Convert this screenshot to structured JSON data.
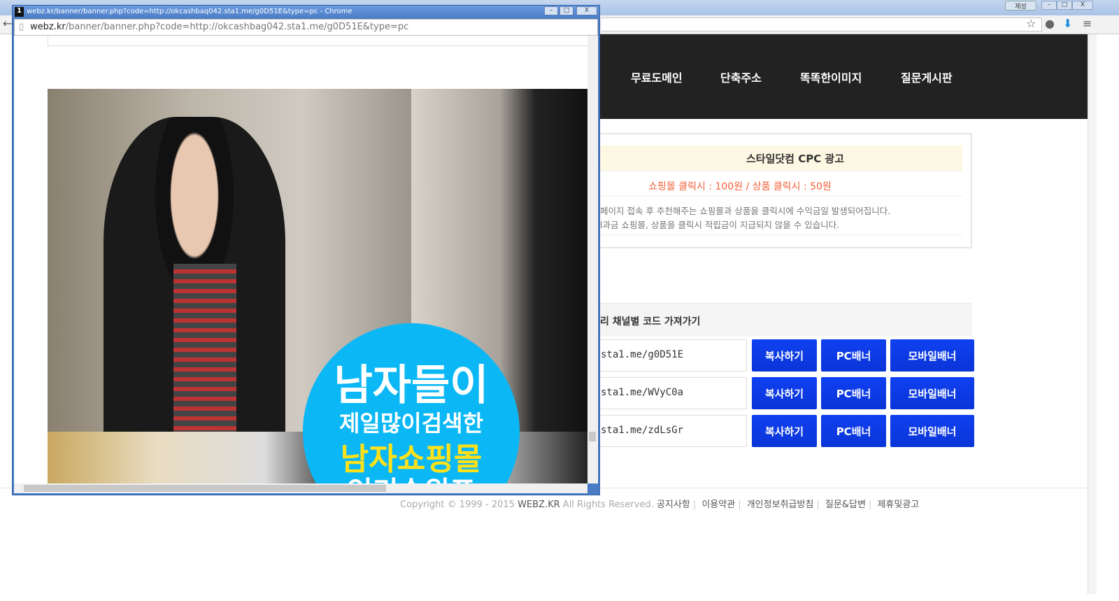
{
  "browser": {
    "warning_label": "제성",
    "icons": [
      "star-icon",
      "extension-icon",
      "download-icon",
      "menu-icon"
    ]
  },
  "nav": {
    "items": [
      "무료도메인",
      "단축주소",
      "똑똑한이미지",
      "질문게시판"
    ]
  },
  "cpc": {
    "title": "스타일닷컴 CPC 광고",
    "price": "쇼핑몰 클릭시 : 100원 / 상품 클릭시 : 50원",
    "desc1": "페이지 접속 후 추천해주는 쇼핑몰과 상품을 클릭시에 수익금일 발생되어집니다.",
    "desc2": "l과금 쇼핑몰, 상품을 클릭시 적립금이 지급되지 않을 수 있습니다."
  },
  "channels": {
    "title": "리 채널별 코드 가져가기",
    "rows": [
      {
        "url": "sta1.me/g0D51E"
      },
      {
        "url": "sta1.me/WVyC0a"
      },
      {
        "url": "sta1.me/zdLsGr"
      }
    ],
    "copy_label": "복사하기",
    "pc_label": "PC배너",
    "mobile_label": "모바일배너"
  },
  "footer": {
    "copyright": "Copyright © 1999 - 2015",
    "brand": "WEBZ.KR",
    "rights": "All Rights Reserved.",
    "links": [
      "공지사항",
      "이용약관",
      "개인정보취급방침",
      "질문&답변",
      "제휴및광고"
    ]
  },
  "popup": {
    "title": "webz.kr/banner/banner.php?code=http://okcashbaq042.sta1.me/g0D51E&type=pc - Chrome",
    "addr_host": "webz.kr",
    "addr_path": "/banner/banner.php?code=http://okcashbag042.sta1.me/g0D51E&type=pc",
    "banner": {
      "line1": "남자들이",
      "line2": "제일많이검색한",
      "line3": "남자쇼핑몰",
      "line4": "인기순위표",
      "accent": "#0bb8f5",
      "highlight": "#ffe11a"
    }
  }
}
